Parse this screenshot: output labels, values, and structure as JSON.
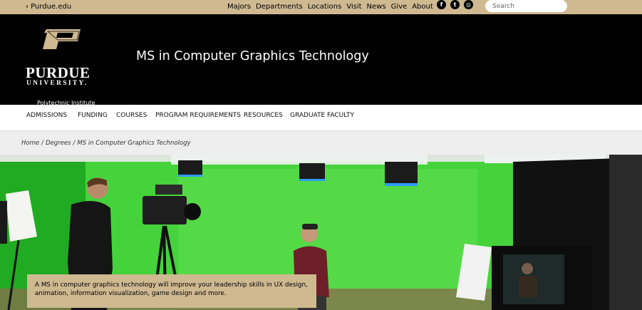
{
  "topbar": {
    "back_link": "‹ Purdue.edu",
    "links": [
      "Majors",
      "Departments",
      "Locations",
      "Visit",
      "News",
      "Give",
      "About"
    ],
    "social": [
      {
        "icon": "facebook-icon",
        "glyph": "f"
      },
      {
        "icon": "twitter-icon",
        "glyph": "t"
      },
      {
        "icon": "instagram-icon",
        "glyph": "◎"
      }
    ],
    "search_placeholder": "Search"
  },
  "header": {
    "wordmark_line1": "PURDUE",
    "wordmark_line2": "UNIVERSITY.",
    "logo_sub": "Polytechnic Institute",
    "site_title": "MS in Computer Graphics Technology"
  },
  "nav": {
    "items": [
      "ADMISSIONS",
      "FUNDING",
      "COURSES",
      "PROGRAM REQUIREMENTS",
      "RESOURCES",
      "GRADUATE FACULTY"
    ]
  },
  "breadcrumb": {
    "items": [
      "Home",
      "Degrees",
      "MS in Computer Graphics Technology"
    ]
  },
  "hero": {
    "caption": "A MS in computer graphics technology will improve your leadership skills in UX design, animation, information visualization, game design and more."
  },
  "colors": {
    "gold": "#cfb991",
    "black": "#000000",
    "green_screen": "#2bc42a"
  }
}
